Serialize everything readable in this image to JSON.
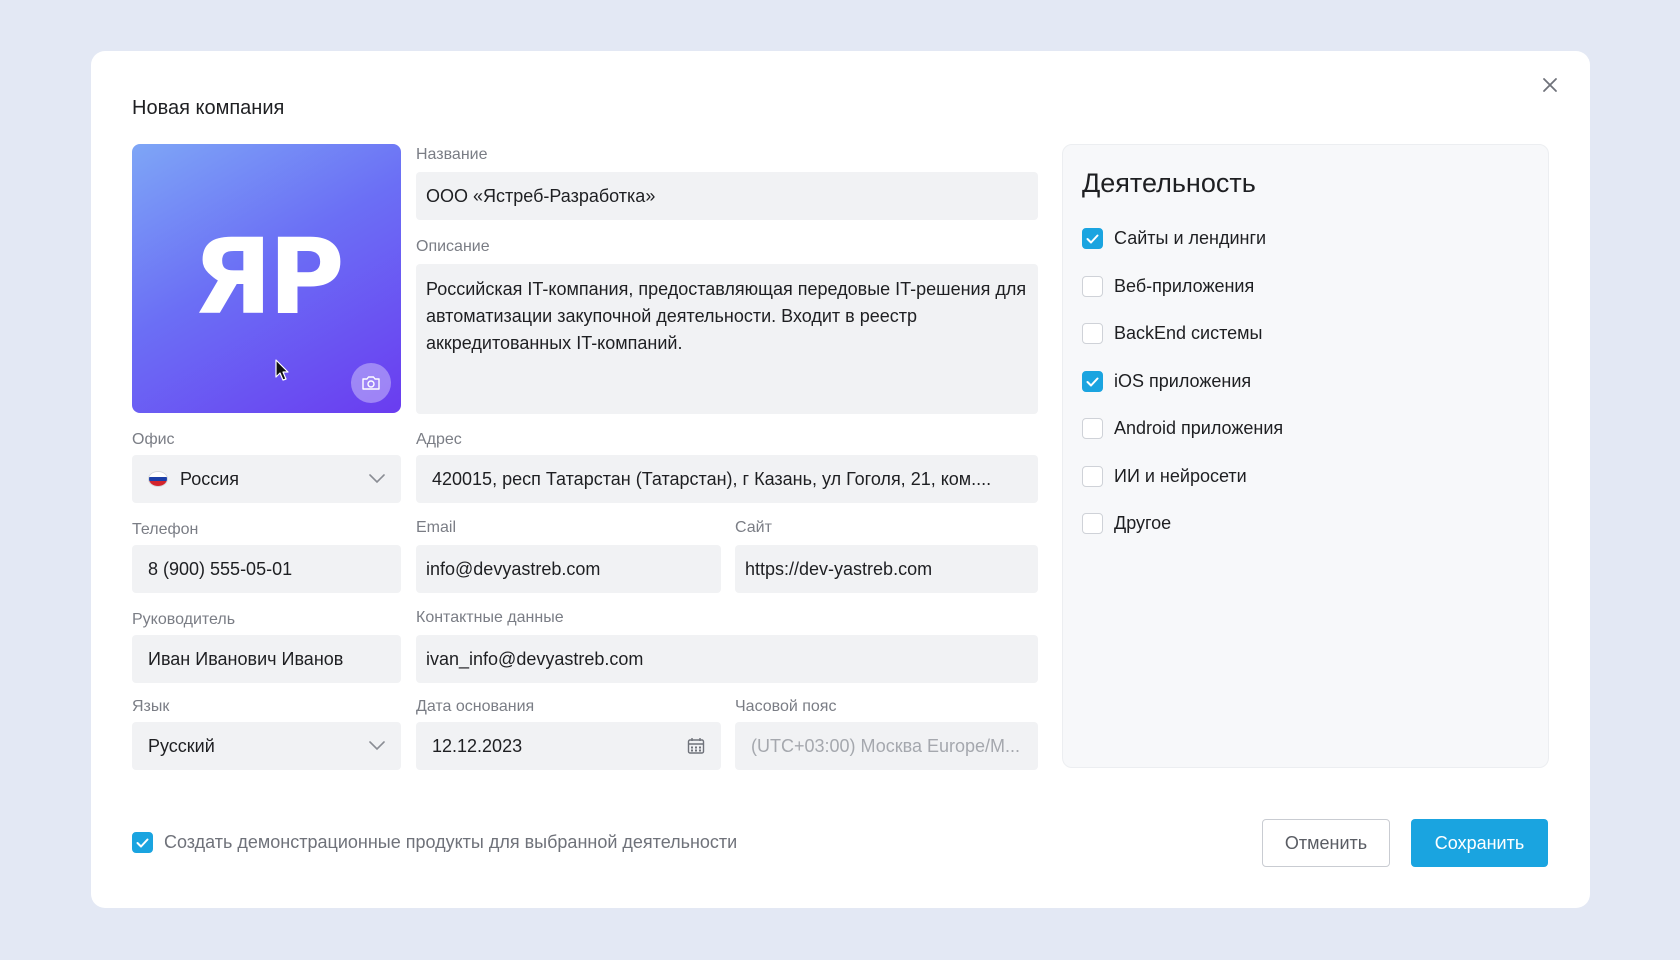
{
  "modal": {
    "title": "Новая компания",
    "close_icon": "close-icon"
  },
  "logo": {
    "initials": "ЯР",
    "camera_icon": "camera-icon",
    "colors": [
      "#7ea6f6",
      "#6b6ff5",
      "#6a3cf0"
    ]
  },
  "form": {
    "name": {
      "label": "Название",
      "value": "ООО «Ястреб-Разработка»"
    },
    "description": {
      "label": "Описание",
      "value": "Российская IT-компания, предоставляющая передовые IT-решения для автоматизации закупочной деятельности. Входит в реестр аккредитованных IT-компаний."
    },
    "office": {
      "label": "Офис",
      "value": "Россия",
      "flag_icon": "russia-flag-icon"
    },
    "address": {
      "label": "Адрес",
      "value": "420015, респ Татарстан (Татарстан), г Казань, ул Гоголя, 21, ком...."
    },
    "phone": {
      "label": "Телефон",
      "value": "8 (900) 555-05-01"
    },
    "email": {
      "label": "Email",
      "value": "info@devyastreb.com"
    },
    "site": {
      "label": "Сайт",
      "value": "https://dev-yastreb.com"
    },
    "manager": {
      "label": "Руководитель",
      "value": "Иван Иванович Иванов"
    },
    "contacts": {
      "label": "Контактные данные",
      "value": "ivan_info@devyastreb.com"
    },
    "language": {
      "label": "Язык",
      "value": "Русский"
    },
    "founded": {
      "label": "Дата основания",
      "value": "12.12.2023",
      "icon": "calendar-icon"
    },
    "timezone": {
      "label": "Часовой пояс",
      "value": "(UTC+03:00) Москва Europe/M..."
    }
  },
  "activity": {
    "title": "Деятельность",
    "items": [
      {
        "label": "Сайты и лендинги",
        "checked": true
      },
      {
        "label": "Веб-приложения",
        "checked": false
      },
      {
        "label": "BackEnd системы",
        "checked": false
      },
      {
        "label": "iOS приложения",
        "checked": true
      },
      {
        "label": "Android приложения",
        "checked": false
      },
      {
        "label": "ИИ и нейросети",
        "checked": false
      },
      {
        "label": "Другое",
        "checked": false
      }
    ]
  },
  "footer": {
    "demo_label": "Создать демонстрационные продукты для выбранной деятельности",
    "demo_checked": true,
    "cancel_label": "Отменить",
    "save_label": "Сохранить"
  },
  "colors": {
    "accent": "#1aa4e0",
    "background": "#e3e8f4",
    "field": "#f1f2f4"
  }
}
